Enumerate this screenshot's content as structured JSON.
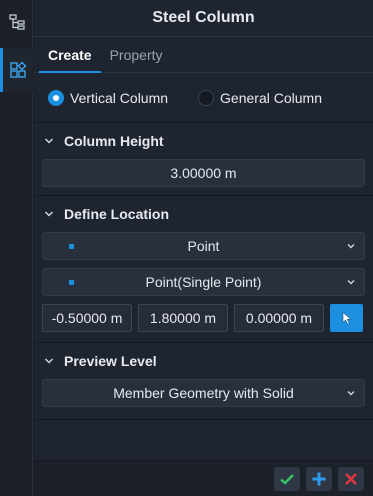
{
  "panel": {
    "title": "Steel Column"
  },
  "tabs": [
    {
      "label": "Create",
      "active": true
    },
    {
      "label": "Property",
      "active": false
    }
  ],
  "column_type": {
    "options": [
      {
        "label": "Vertical Column",
        "checked": true
      },
      {
        "label": "General Column",
        "checked": false
      }
    ]
  },
  "column_height": {
    "header": "Column Height",
    "value": "3.00000 m"
  },
  "define_location": {
    "header": "Define Location",
    "type_value": "Point",
    "mode_value": "Point(Single Point)",
    "coords": [
      "-0.50000 m",
      "1.80000 m",
      "0.00000 m"
    ]
  },
  "preview_level": {
    "header": "Preview Level",
    "value": "Member Geometry with Solid"
  },
  "icons": {
    "rail_tree": "tree-structure-icon",
    "rail_shapes": "shapes-icon",
    "pick": "cursor-arrow-icon",
    "ok": "checkmark-icon",
    "add": "plus-icon",
    "cancel": "close-icon"
  },
  "colors": {
    "accent": "#1c8fe0",
    "ok": "#35c46a",
    "cancel": "#e0383e"
  }
}
